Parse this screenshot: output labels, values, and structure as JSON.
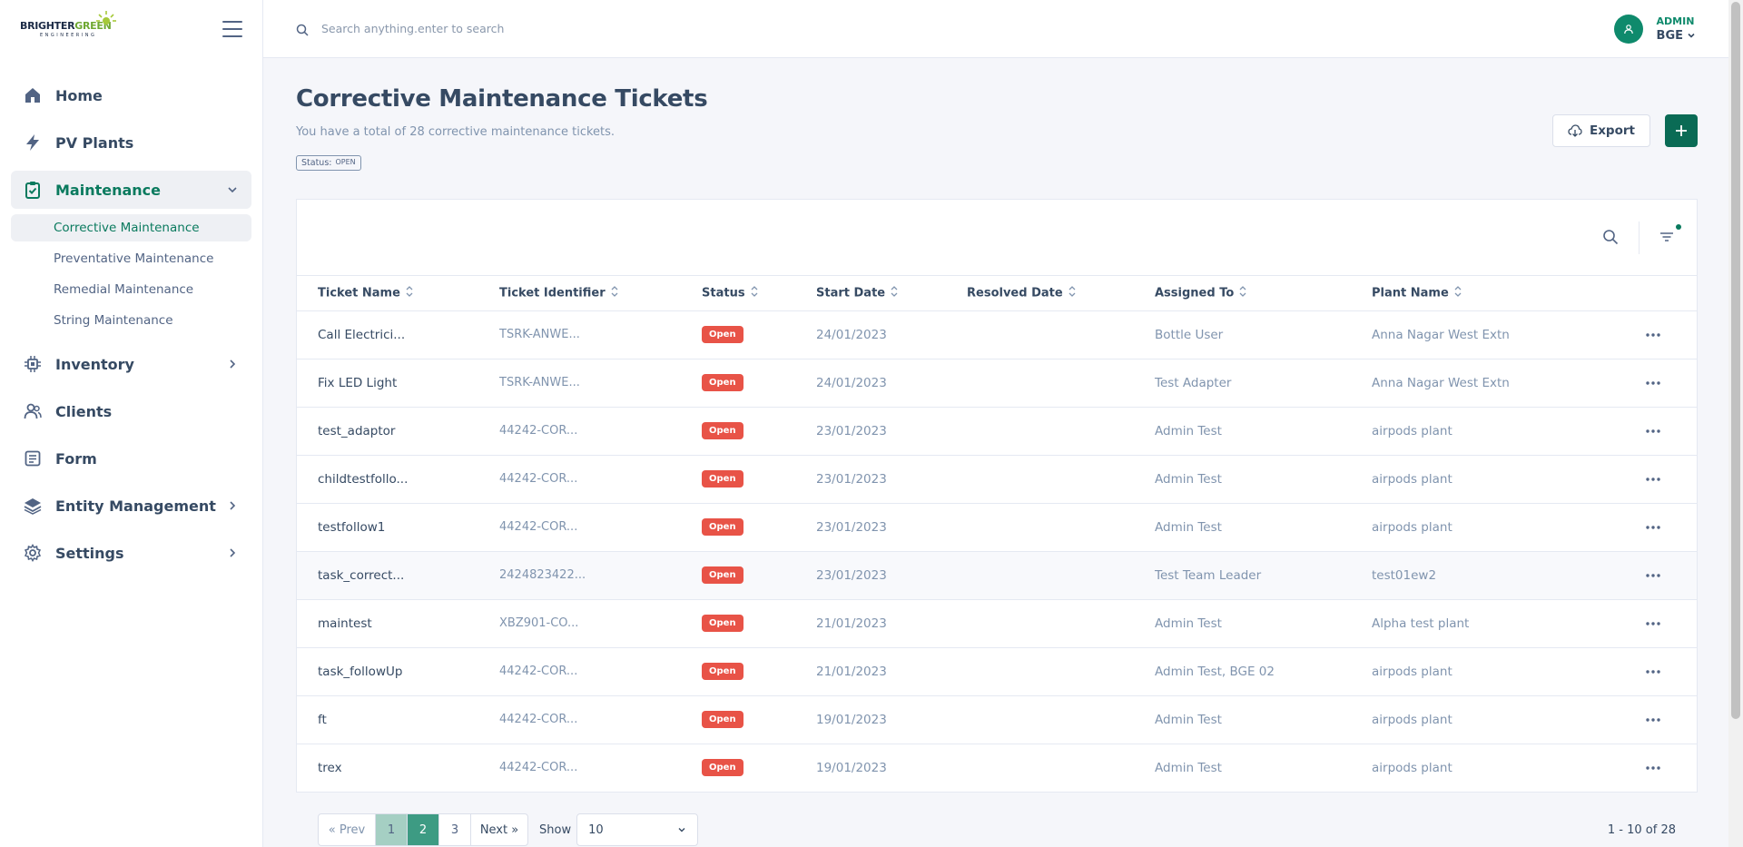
{
  "brand": {
    "logo_main": "BRIGHTER",
    "logo_accent": "GREEN",
    "logo_sub": "ENGINEERING"
  },
  "sidebar": {
    "items": [
      {
        "label": "Home",
        "icon": "home-icon"
      },
      {
        "label": "PV Plants",
        "icon": "bolt-icon"
      },
      {
        "label": "Maintenance",
        "icon": "clipboard-check-icon",
        "expanded": true
      },
      {
        "label": "Inventory",
        "icon": "chip-icon"
      },
      {
        "label": "Clients",
        "icon": "users-icon"
      },
      {
        "label": "Form",
        "icon": "form-icon"
      },
      {
        "label": "Entity Management",
        "icon": "layers-icon"
      },
      {
        "label": "Settings",
        "icon": "gear-icon"
      }
    ],
    "maintenance_sub": [
      {
        "label": "Corrective Maintenance",
        "active": true
      },
      {
        "label": "Preventative Maintenance"
      },
      {
        "label": "Remedial Maintenance"
      },
      {
        "label": "String Maintenance"
      }
    ]
  },
  "header": {
    "search_placeholder": "Search anything.enter to search",
    "user_role": "ADMIN",
    "user_name": "BGE"
  },
  "page": {
    "title": "Corrective Maintenance Tickets",
    "subtitle": "You have a total of 28 corrective maintenance tickets.",
    "filter_chip_label": "Status:",
    "filter_chip_value": "OPEN",
    "export_label": "Export"
  },
  "table": {
    "columns": [
      "Ticket Name",
      "Ticket Identifier",
      "Status",
      "Start Date",
      "Resolved Date",
      "Assigned To",
      "Plant Name"
    ],
    "rows": [
      {
        "name": "Call Electrici...",
        "id": "TSRK-ANWE...",
        "status": "Open",
        "start": "24/01/2023",
        "resolved": "",
        "assigned": "Bottle User",
        "plant": "Anna Nagar West Extn"
      },
      {
        "name": "Fix LED Light",
        "id": "TSRK-ANWE...",
        "status": "Open",
        "start": "24/01/2023",
        "resolved": "",
        "assigned": "Test Adapter",
        "plant": "Anna Nagar West Extn"
      },
      {
        "name": "test_adaptor",
        "id": "44242-COR...",
        "status": "Open",
        "start": "23/01/2023",
        "resolved": "",
        "assigned": "Admin Test",
        "plant": "airpods plant"
      },
      {
        "name": "childtestfollo...",
        "id": "44242-COR...",
        "status": "Open",
        "start": "23/01/2023",
        "resolved": "",
        "assigned": "Admin Test",
        "plant": "airpods plant"
      },
      {
        "name": "testfollow1",
        "id": "44242-COR...",
        "status": "Open",
        "start": "23/01/2023",
        "resolved": "",
        "assigned": "Admin Test",
        "plant": "airpods plant"
      },
      {
        "name": "task_correct...",
        "id": "2424823422...",
        "status": "Open",
        "start": "23/01/2023",
        "resolved": "",
        "assigned": "Test Team Leader",
        "plant": "test01ew2"
      },
      {
        "name": "maintest",
        "id": "XBZ901-CO...",
        "status": "Open",
        "start": "21/01/2023",
        "resolved": "",
        "assigned": "Admin Test",
        "plant": "Alpha test plant"
      },
      {
        "name": "task_followUp",
        "id": "44242-COR...",
        "status": "Open",
        "start": "21/01/2023",
        "resolved": "",
        "assigned": "Admin Test, BGE 02",
        "plant": "airpods plant"
      },
      {
        "name": "ft",
        "id": "44242-COR...",
        "status": "Open",
        "start": "19/01/2023",
        "resolved": "",
        "assigned": "Admin Test",
        "plant": "airpods plant"
      },
      {
        "name": "trex",
        "id": "44242-COR...",
        "status": "Open",
        "start": "19/01/2023",
        "resolved": "",
        "assigned": "Admin Test",
        "plant": "airpods plant"
      }
    ]
  },
  "pagination": {
    "prev": "« Prev",
    "pages": [
      "1",
      "2",
      "3"
    ],
    "current": "2",
    "next": "Next »",
    "show_label": "Show",
    "page_size": "10",
    "range": "1 - 10 of 28"
  },
  "colors": {
    "accent": "#0a7a5e",
    "badge_open": "#e85347",
    "add_button": "#0a6b55"
  }
}
